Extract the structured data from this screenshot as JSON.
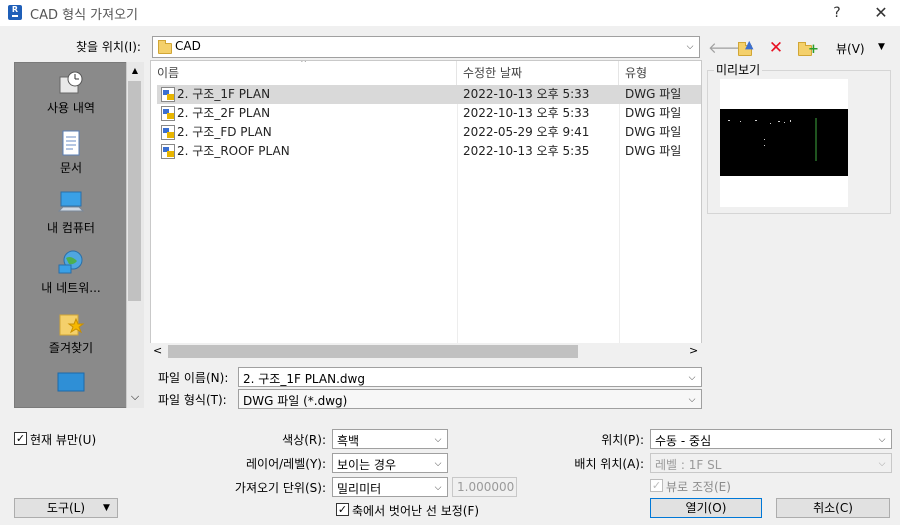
{
  "window": {
    "title": "CAD 형식 가져오기",
    "help": "?",
    "close": "✕"
  },
  "look_in": {
    "label": "찾을 위치(I):",
    "value": "CAD"
  },
  "toolbar": {
    "back": "🡐",
    "new_folder": "+",
    "delete": "✕",
    "view_label": "뷰(V)"
  },
  "places": [
    {
      "label": "사용 내역",
      "icon": "history-icon"
    },
    {
      "label": "문서",
      "icon": "documents-icon"
    },
    {
      "label": "내 컴퓨터",
      "icon": "computer-icon"
    },
    {
      "label": "내 네트워...",
      "icon": "network-icon"
    },
    {
      "label": "즐겨찾기",
      "icon": "favorites-icon"
    }
  ],
  "file_list": {
    "columns": [
      "이름",
      "수정한 날짜",
      "유형"
    ],
    "rows": [
      {
        "name": "2. 구조_1F PLAN",
        "date": "2022-10-13 오후 5:33",
        "type": "DWG 파일"
      },
      {
        "name": "2. 구조_2F PLAN",
        "date": "2022-10-13 오후 5:33",
        "type": "DWG 파일"
      },
      {
        "name": "2. 구조_FD PLAN",
        "date": "2022-05-29 오후 9:41",
        "type": "DWG 파일"
      },
      {
        "name": "2. 구조_ROOF PLAN",
        "date": "2022-10-13 오후 5:35",
        "type": "DWG 파일"
      }
    ],
    "selected_index": 0
  },
  "preview": {
    "label": "미리보기"
  },
  "file_name": {
    "label": "파일 이름(N):",
    "value": "2. 구조_1F PLAN.dwg"
  },
  "file_type": {
    "label": "파일 형식(T):",
    "value": "DWG 파일 (*.dwg)"
  },
  "options": {
    "current_view_only": {
      "label": "현재 뷰만(U)",
      "checked": true
    },
    "colors": {
      "label": "색상(R):",
      "value": "흑백"
    },
    "layers": {
      "label": "레이어/레벨(Y):",
      "value": "보이는 경우"
    },
    "import_units": {
      "label": "가져오기 단위(S):",
      "value": "밀리미터",
      "factor": "1.000000"
    },
    "correct_lines": {
      "label": "축에서 벗어난 선 보정(F)",
      "checked": true
    },
    "positioning": {
      "label": "위치(P):",
      "value": "수동 - 중심"
    },
    "place_at": {
      "label": "배치 위치(A):",
      "value": "레벨 : 1F SL"
    },
    "orient_to_view": {
      "label": "뷰로 조정(E)",
      "checked": true
    }
  },
  "buttons": {
    "tools": "도구(L)",
    "open": "열기(O)",
    "cancel": "취소(C)"
  },
  "glyphs": {
    "check": "✓",
    "down": "⌵",
    "dropdown": "▼",
    "up": "▲",
    "left": "<",
    "right": ">",
    "sort_up": "⌃"
  },
  "colors": {
    "accent": "#0078d7",
    "selected_row": "#d9d9d9",
    "places_bg": "#8a8a8a",
    "delete_red": "#e81123"
  }
}
